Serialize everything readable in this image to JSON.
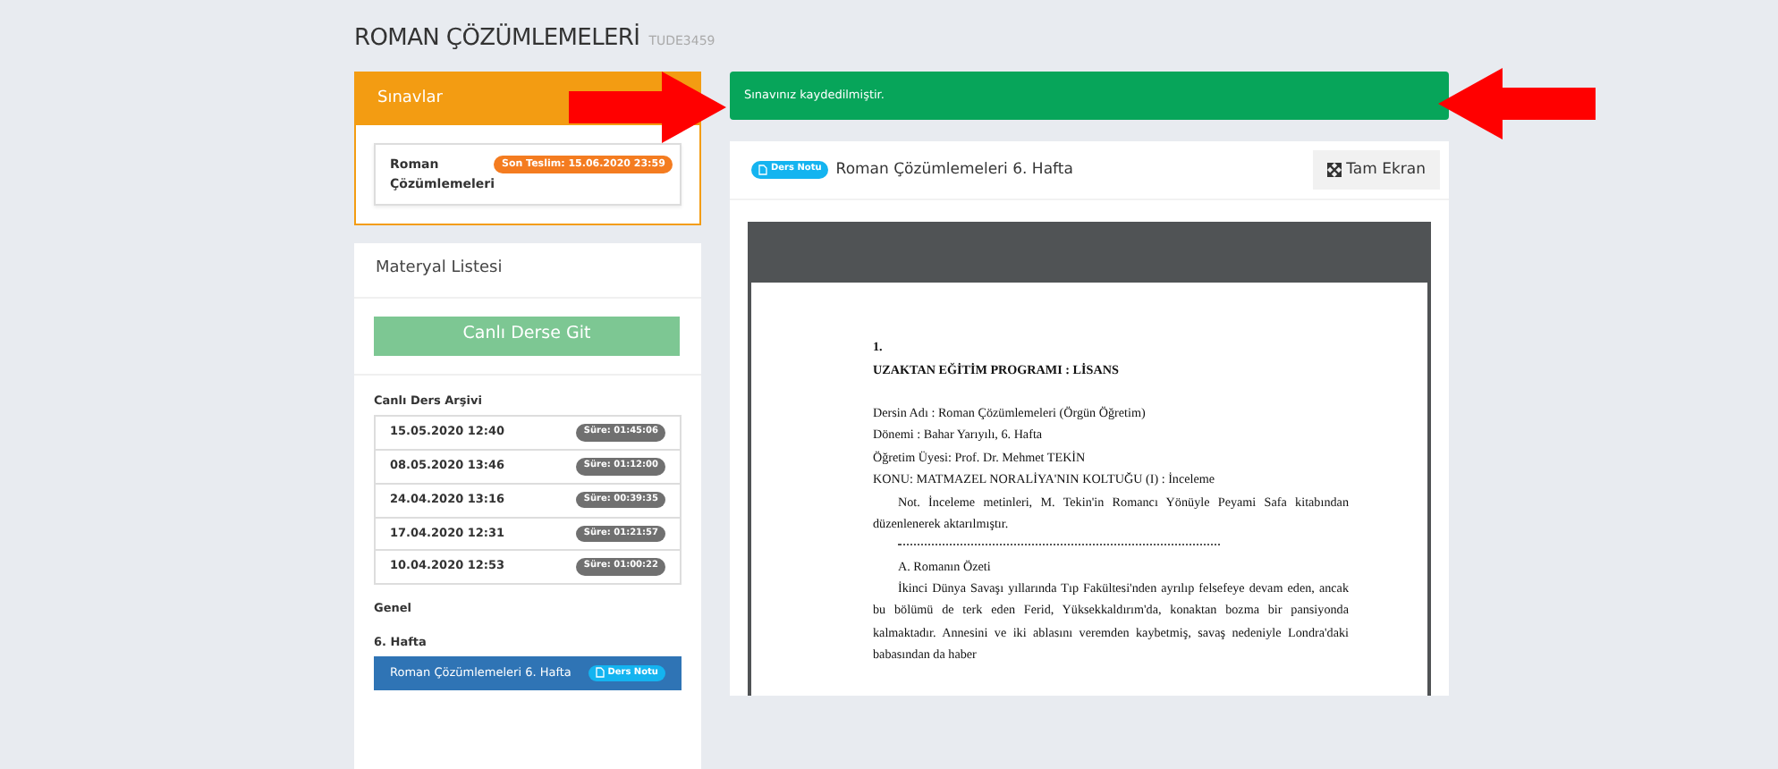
{
  "course": {
    "title": "ROMAN ÇÖZÜMLEMELERİ",
    "code": "TUDE3459"
  },
  "exams": {
    "title": "Sınavlar",
    "items": [
      {
        "name": "Roman Çözümlemeleri",
        "deadline": "Son Teslim: 15.06.2020 23:59"
      }
    ]
  },
  "materials": {
    "title": "Materyal Listesi",
    "live_button": "Canlı Derse Git",
    "archive_title": "Canlı Ders Arşivi",
    "archive": [
      {
        "date": "15.05.2020 12:40",
        "duration": "Süre: 01:45:06"
      },
      {
        "date": "08.05.2020 13:46",
        "duration": "Süre: 01:12:00"
      },
      {
        "date": "24.04.2020 13:16",
        "duration": "Süre: 00:39:35"
      },
      {
        "date": "17.04.2020 12:31",
        "duration": "Süre: 01:21:57"
      },
      {
        "date": "10.04.2020 12:53",
        "duration": "Süre: 01:00:22"
      }
    ],
    "sections": [
      {
        "title": "Genel"
      },
      {
        "title": "6. Hafta",
        "items": [
          {
            "label": "Roman Çözümlemeleri 6. Hafta",
            "badge": "Ders Notu",
            "selected": true
          }
        ]
      }
    ]
  },
  "alert": {
    "text": "Sınavınız kaydedilmiştir."
  },
  "viewer": {
    "badge": "Ders Notu",
    "title": "Roman Çözümlemeleri 6. Hafta",
    "fullscreen_button": "Tam Ekran",
    "document": [
      {
        "kind": "heading",
        "text": "1."
      },
      {
        "kind": "heading",
        "text": "UZAKTAN EĞİTİM PROGRAMI : LİSANS"
      },
      {
        "kind": "line",
        "text": "Dersin Adı : Roman Çözümlemeleri (Örgün Öğretim)"
      },
      {
        "kind": "line",
        "text": "Dönemi : Bahar Yarıyılı, 6. Hafta"
      },
      {
        "kind": "line",
        "text": "Öğretim Üyesi: Prof. Dr. Mehmet TEKİN"
      },
      {
        "kind": "line",
        "text": "KONU: MATMAZEL NORALİYA'NIN KOLTUĞU (I) : İnceleme"
      },
      {
        "kind": "paragraph",
        "text": "Not. İnceleme metinleri, M. Tekin'in Romancı Yönüyle Peyami Safa kitabından düzenlenerek aktarılmıştır."
      },
      {
        "kind": "rule"
      },
      {
        "kind": "subheading",
        "text": "A.  Romanın Özeti"
      },
      {
        "kind": "paragraph",
        "text": "İkinci Dünya Savaşı yıllarında Tıp Fakültesi'nden ayrılıp felsefeye devam eden, ancak bu bölümü de terk eden Ferid, Yüksekkaldırım'da, konaktan bozma bir pansiyonda kalmaktadır. Annesini ve iki ablasını veremden kaybetmiş, savaş nedeniyle Londra'daki babasından da haber"
      }
    ]
  }
}
